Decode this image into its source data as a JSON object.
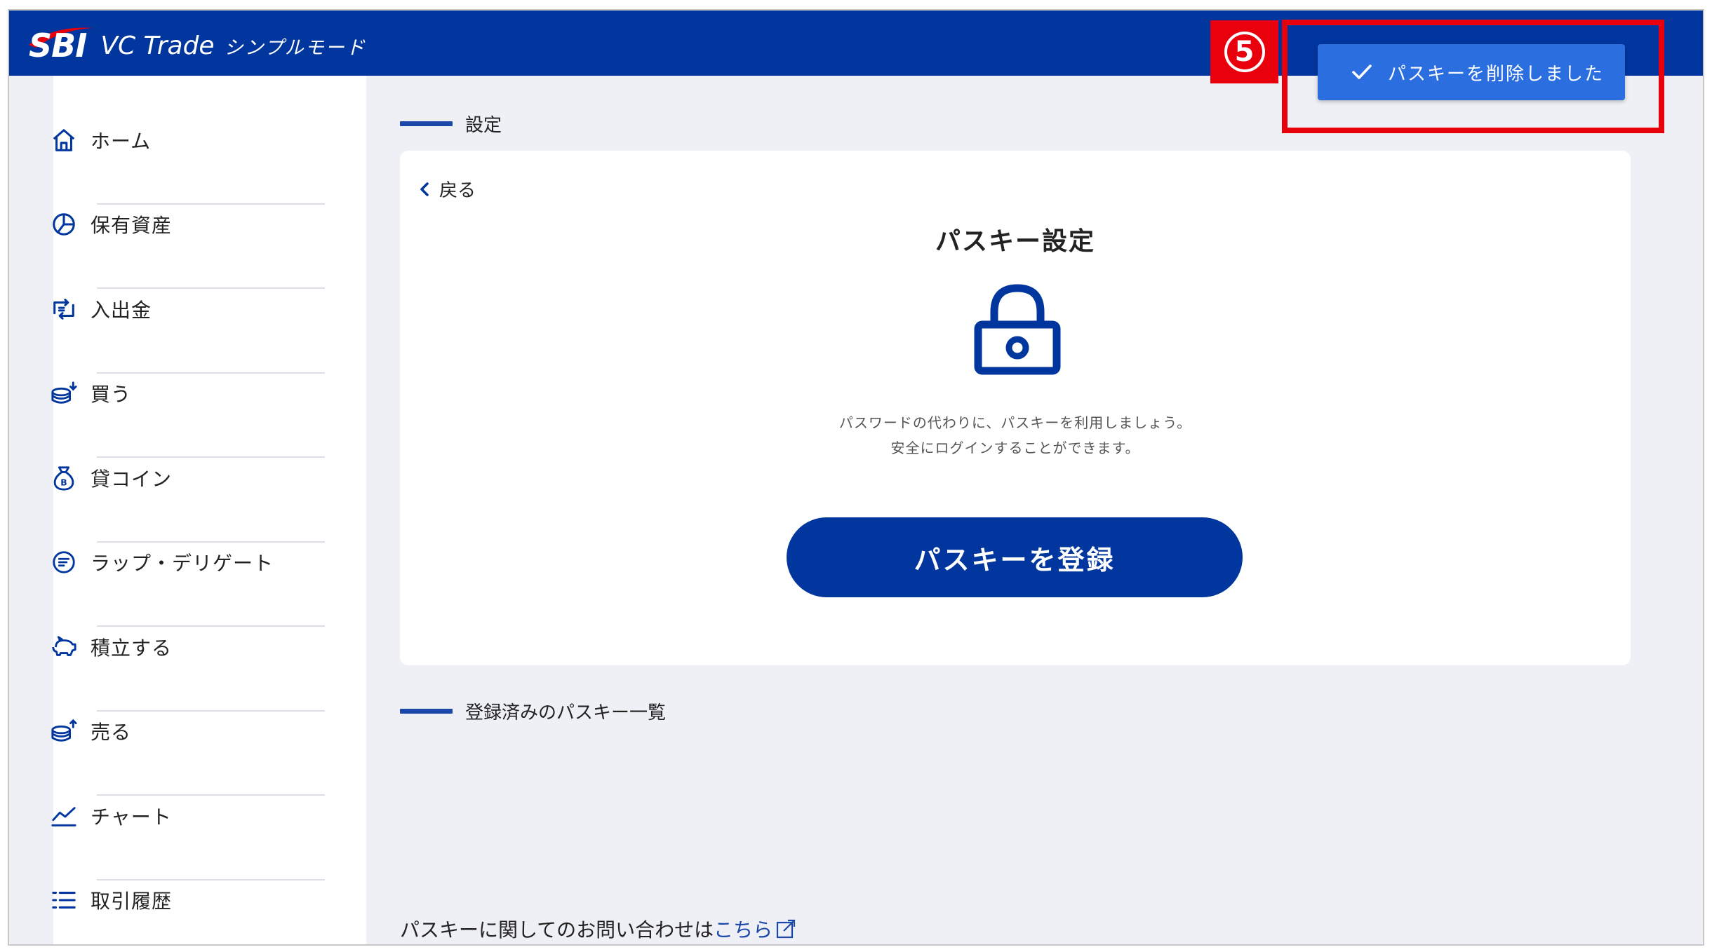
{
  "header": {
    "logo_sbi": "SBI",
    "logo_vc": "VC Trade",
    "logo_mode": "シンプルモード",
    "brand_color": "#00369e"
  },
  "sidebar": {
    "items": [
      {
        "label": "ホーム",
        "icon": "home-icon"
      },
      {
        "label": "保有資産",
        "icon": "pie-chart-icon"
      },
      {
        "label": "入出金",
        "icon": "transfer-icon"
      },
      {
        "label": "買う",
        "icon": "coins-buy-icon"
      },
      {
        "label": "貸コイン",
        "icon": "coin-bag-icon"
      },
      {
        "label": "ラップ・デリゲート",
        "icon": "wrap-delegate-icon"
      },
      {
        "label": "積立する",
        "icon": "piggy-bank-icon"
      },
      {
        "label": "売る",
        "icon": "coins-sell-icon"
      },
      {
        "label": "チャート",
        "icon": "line-chart-icon"
      },
      {
        "label": "取引履歴",
        "icon": "list-icon"
      }
    ]
  },
  "main": {
    "section_settings": "設定",
    "back_label": "戻る",
    "card_title": "パスキー設定",
    "description_line1": "パスワードの代わりに、パスキーを利用しましょう。",
    "description_line2": "安全にログインすることができます。",
    "register_button": "パスキーを登録",
    "section_registered": "登録済みのパスキー一覧",
    "contact_prefix": "パスキーに関してのお問い合わせは",
    "contact_link": "こちら"
  },
  "toast": {
    "message": "パスキーを削除しました",
    "color": "#2a6ee0"
  },
  "annotation": {
    "step_number": "5",
    "highlight_color": "#e8000c"
  }
}
